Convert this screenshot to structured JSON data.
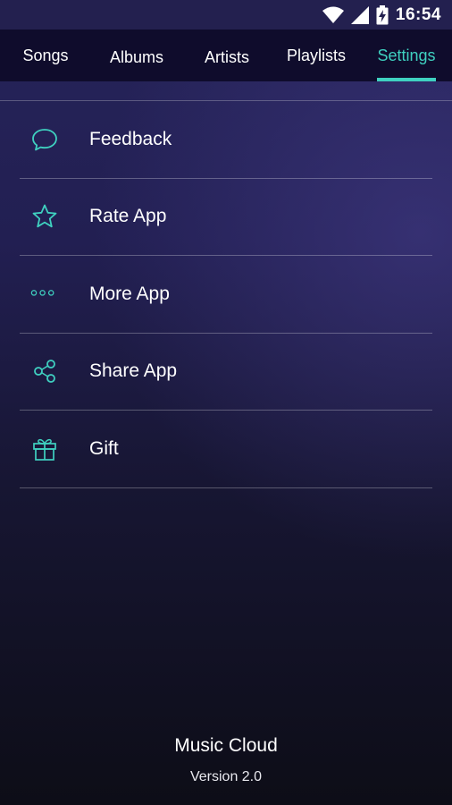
{
  "status_bar": {
    "time": "16:54",
    "icons": [
      "wifi-icon",
      "signal-icon",
      "battery-charging-icon"
    ]
  },
  "tabs": [
    {
      "label": "Songs",
      "active": false
    },
    {
      "label": "Albums",
      "active": false
    },
    {
      "label": "Artists",
      "active": false
    },
    {
      "label": "Playlists",
      "active": false
    },
    {
      "label": "Settings",
      "active": true
    }
  ],
  "menu": {
    "items": [
      {
        "label": "Feedback",
        "icon": "speech-bubble-icon"
      },
      {
        "label": "Rate App",
        "icon": "star-icon"
      },
      {
        "label": "More App",
        "icon": "more-dots-icon"
      },
      {
        "label": "Share App",
        "icon": "share-icon"
      },
      {
        "label": "Gift",
        "icon": "gift-icon"
      }
    ]
  },
  "footer": {
    "app_name": "Music Cloud",
    "version": "Version 2.0"
  },
  "colors": {
    "accent": "#3fd1c0",
    "tab_bar": "#0f0c2c",
    "status_bar": "#23204f"
  }
}
